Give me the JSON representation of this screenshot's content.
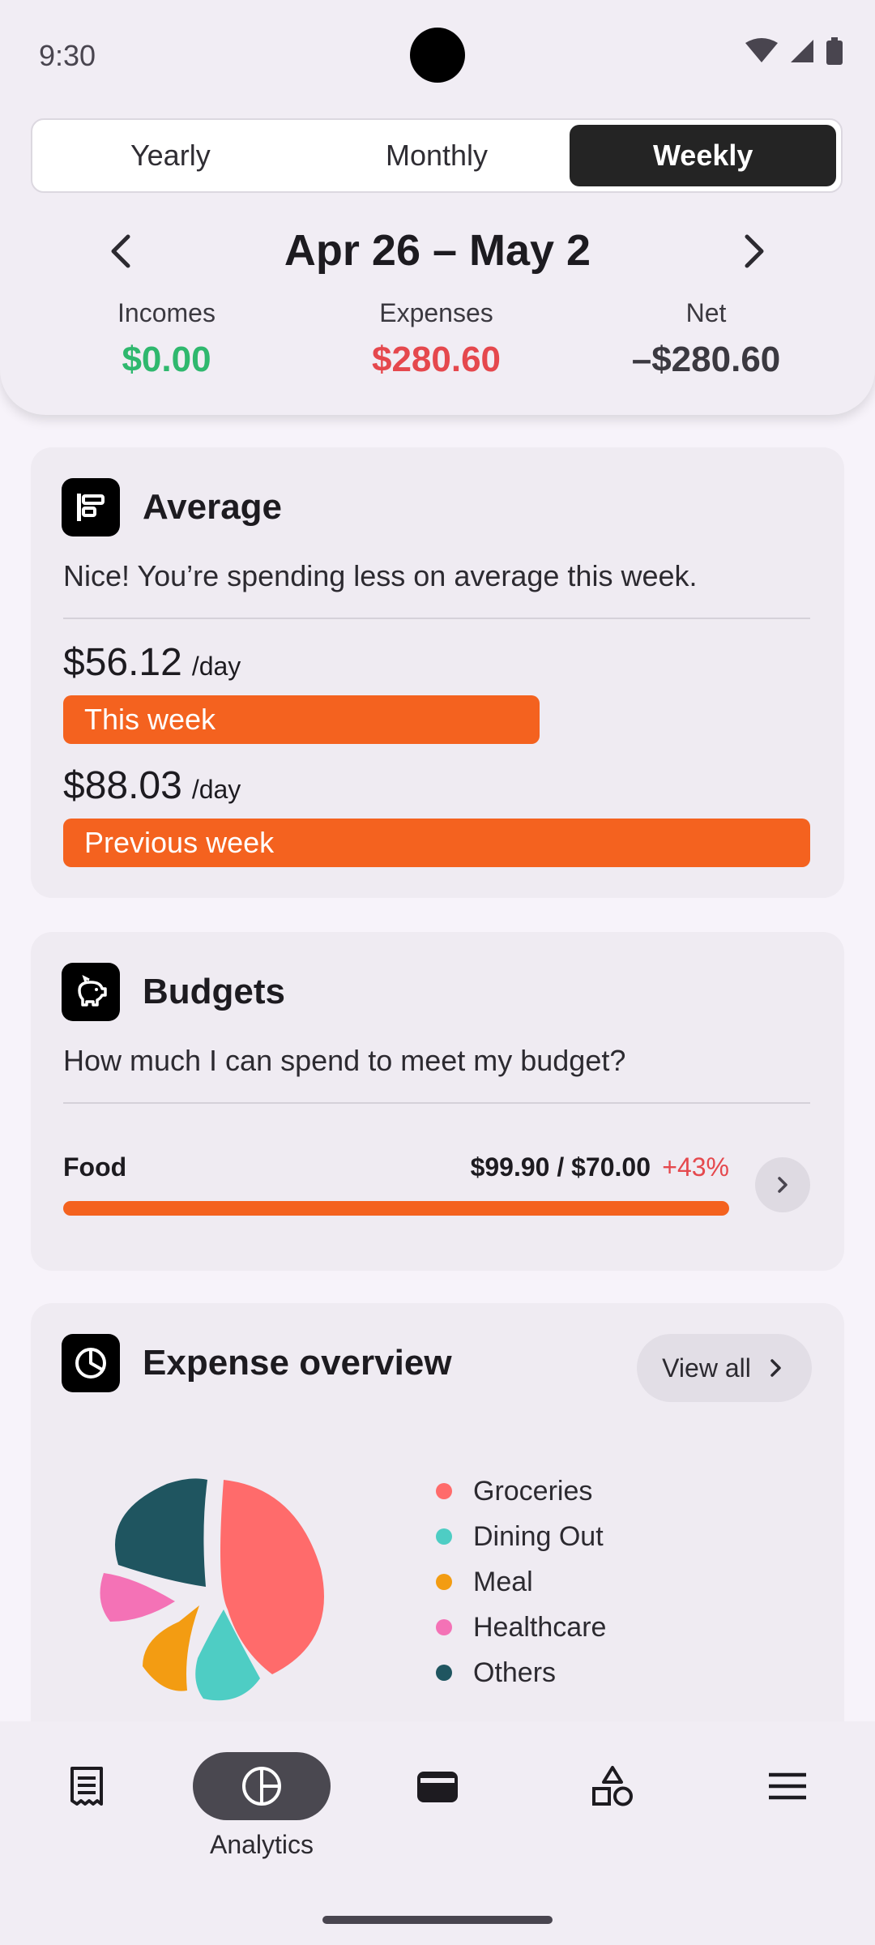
{
  "status_bar": {
    "time": "9:30"
  },
  "period_tabs": [
    "Yearly",
    "Monthly",
    "Weekly"
  ],
  "active_tab": "Weekly",
  "period": {
    "label": "Apr 26 – May 2"
  },
  "summary": [
    {
      "title": "Incomes",
      "value": "$0.00",
      "color": "#2fb86e"
    },
    {
      "title": "Expenses",
      "value": "$280.60",
      "color": "#e5484d"
    },
    {
      "title": "Net",
      "value": "–$280.60",
      "color": "#3b3940"
    }
  ],
  "average": {
    "title": "Average",
    "message": "Nice! You’re spending less on average this week.",
    "this_week": {
      "amount": "$56.12",
      "unit": "/day",
      "label": "This week",
      "ratio": 0.6375
    },
    "previous_week": {
      "amount": "$88.03",
      "unit": "/day",
      "label": "Previous week",
      "ratio": 1.0
    }
  },
  "budgets": {
    "title": "Budgets",
    "question": "How much I can spend to meet my budget?",
    "items": [
      {
        "category": "Food",
        "amount": "$99.90 / $70.00",
        "percent": "+43%",
        "progress": 1.0
      }
    ]
  },
  "expense_overview": {
    "title": "Expense overview",
    "view_all": "View all",
    "legend": [
      {
        "name": "Groceries",
        "color": "#ff6b6b"
      },
      {
        "name": "Dining Out",
        "color": "#4ecdc4"
      },
      {
        "name": "Meal",
        "color": "#f39c12"
      },
      {
        "name": "Healthcare",
        "color": "#f472b6"
      },
      {
        "name": "Others",
        "color": "#1f5560"
      }
    ]
  },
  "bottom_nav": {
    "items": [
      {
        "id": "transactions",
        "icon": "receipt-icon",
        "label": ""
      },
      {
        "id": "analytics",
        "icon": "analytics-icon",
        "label": "Analytics"
      },
      {
        "id": "wallet",
        "icon": "wallet-icon",
        "label": ""
      },
      {
        "id": "categories",
        "icon": "shapes-icon",
        "label": ""
      },
      {
        "id": "menu",
        "icon": "menu-icon",
        "label": ""
      }
    ]
  }
}
